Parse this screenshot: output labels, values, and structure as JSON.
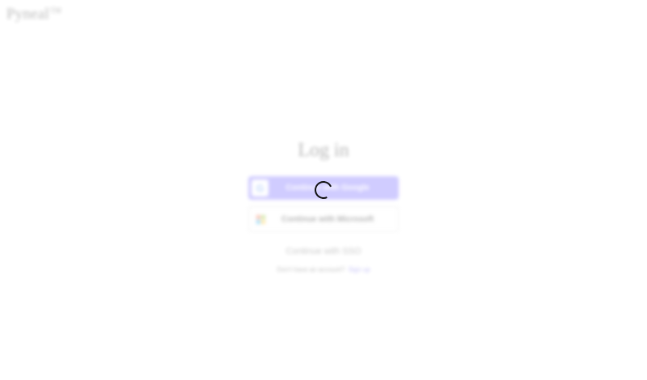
{
  "brand": {
    "name": "Pyneal",
    "trademark": "TM"
  },
  "login": {
    "title": "Log in",
    "google_label": "Continue with Google",
    "google_icon": "google-icon",
    "microsoft_label": "Continue with Microsoft",
    "microsoft_icon": "microsoft-icon",
    "sso_label": "Continue with SSO",
    "signup_prompt": "Don't have an account?",
    "signup_link": "Sign up"
  },
  "colors": {
    "primary": "#6f62ff",
    "link": "#4f46e5",
    "spinner": "#111111"
  },
  "state": {
    "loading": true
  }
}
